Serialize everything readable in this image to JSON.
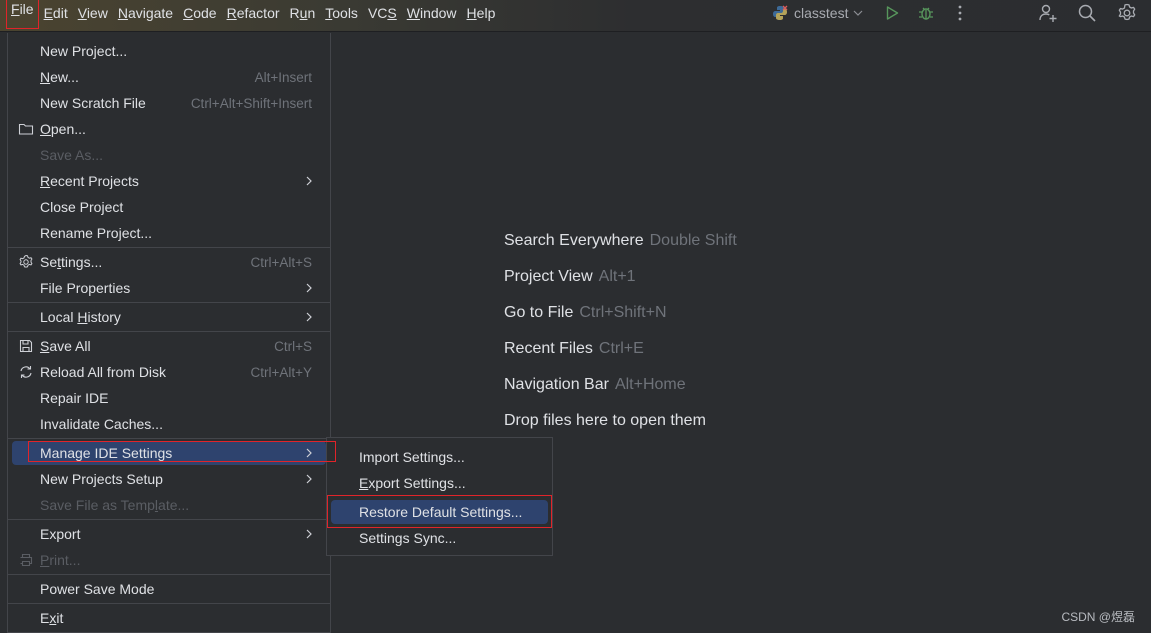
{
  "menubar": {
    "items": [
      {
        "label": "File",
        "mnemonic_index": 0,
        "active": true
      },
      {
        "label": "Edit",
        "mnemonic_index": 0
      },
      {
        "label": "View",
        "mnemonic_index": 0
      },
      {
        "label": "Navigate",
        "mnemonic_index": 0
      },
      {
        "label": "Code",
        "mnemonic_index": 0
      },
      {
        "label": "Refactor",
        "mnemonic_index": 0
      },
      {
        "label": "Run",
        "mnemonic_index": 1
      },
      {
        "label": "Tools",
        "mnemonic_index": 0
      },
      {
        "label": "VCS",
        "mnemonic_index": 2
      },
      {
        "label": "Window",
        "mnemonic_index": 0
      },
      {
        "label": "Help",
        "mnemonic_index": 0
      }
    ]
  },
  "toolbar": {
    "project_name": "classtest",
    "icons": [
      "python-icon",
      "chevron-down-icon",
      "run-icon",
      "debug-icon",
      "more-vertical-icon",
      "add-user-icon",
      "search-icon",
      "gear-icon"
    ],
    "colors": {
      "run": "#57965c",
      "debug": "#57965c"
    }
  },
  "file_menu": {
    "items": [
      {
        "label": "New Project...",
        "shortcut": ""
      },
      {
        "label": "New...",
        "shortcut": "Alt+Insert",
        "mnemonic": "N"
      },
      {
        "label": "New Scratch File",
        "shortcut": "Ctrl+Alt+Shift+Insert"
      },
      {
        "label": "Open...",
        "shortcut": "",
        "icon": "folder-icon",
        "mnemonic": "O"
      },
      {
        "label": "Save As...",
        "shortcut": "",
        "disabled": true
      },
      {
        "label": "Recent Projects",
        "submenu": true,
        "mnemonic": "R"
      },
      {
        "label": "Close Project",
        "shortcut": ""
      },
      {
        "label": "Rename Project...",
        "shortcut": ""
      },
      {
        "label": "Settings...",
        "shortcut": "Ctrl+Alt+S",
        "icon": "gear-icon",
        "mnemonic": "t"
      },
      {
        "label": "File Properties",
        "submenu": true
      },
      {
        "label": "Local History",
        "submenu": true,
        "mnemonic": "H"
      },
      {
        "label": "Save All",
        "shortcut": "Ctrl+S",
        "icon": "save-icon",
        "mnemonic": "S"
      },
      {
        "label": "Reload All from Disk",
        "shortcut": "Ctrl+Alt+Y",
        "icon": "reload-icon"
      },
      {
        "label": "Repair IDE",
        "shortcut": ""
      },
      {
        "label": "Invalidate Caches...",
        "shortcut": ""
      },
      {
        "label": "Manage IDE Settings",
        "submenu": true,
        "selected": true
      },
      {
        "label": "New Projects Setup",
        "submenu": true
      },
      {
        "label": "Save File as Template...",
        "disabled": true
      },
      {
        "label": "Export",
        "submenu": true
      },
      {
        "label": "Print...",
        "disabled": true,
        "icon": "print-icon",
        "mnemonic": "P"
      },
      {
        "label": "Power Save Mode",
        "shortcut": ""
      },
      {
        "label": "Exit",
        "shortcut": "",
        "mnemonic": "x"
      }
    ]
  },
  "submenu": {
    "items": [
      {
        "label": "Import Settings..."
      },
      {
        "label": "Export Settings...",
        "mnemonic": "E"
      },
      {
        "label": "Restore Default Settings...",
        "selected": true
      },
      {
        "label": "Settings Sync..."
      }
    ]
  },
  "welcome_hints": [
    {
      "label": "Search Everywhere",
      "shortcut": "Double Shift"
    },
    {
      "label": "Project View",
      "shortcut": "Alt+1"
    },
    {
      "label": "Go to File",
      "shortcut": "Ctrl+Shift+N"
    },
    {
      "label": "Recent Files",
      "shortcut": "Ctrl+E"
    },
    {
      "label": "Navigation Bar",
      "shortcut": "Alt+Home"
    },
    {
      "label": "Drop files here to open them",
      "shortcut": ""
    }
  ],
  "watermark": "CSDN @煜磊",
  "colors": {
    "selection": "#2e436e",
    "highlight_box": "#e0242a",
    "background": "#2b2d30"
  }
}
